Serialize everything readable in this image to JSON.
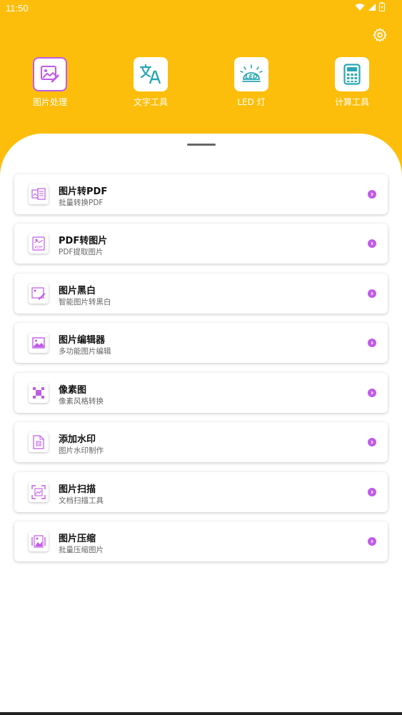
{
  "status_bar": {
    "time": "11:50"
  },
  "colors": {
    "header_bg": "#FDBE0B",
    "accent": "#C15BE8"
  },
  "top_tools": [
    {
      "label": "图片处理",
      "icon": "image-edit-icon",
      "active": true
    },
    {
      "label": "文字工具",
      "icon": "translate-icon",
      "active": false
    },
    {
      "label": "LED 灯",
      "icon": "led-icon",
      "active": false
    },
    {
      "label": "计算工具",
      "icon": "calculator-icon",
      "active": false
    }
  ],
  "features": [
    {
      "title": "图片转PDF",
      "subtitle": "批量转换PDF",
      "icon": "image-to-pdf-icon"
    },
    {
      "title": "PDF转图片",
      "subtitle": "PDF提取图片",
      "icon": "pdf-to-image-icon"
    },
    {
      "title": "图片黑白",
      "subtitle": "智能图片转黑白",
      "icon": "black-white-icon"
    },
    {
      "title": "图片编辑器",
      "subtitle": "多功能图片编辑",
      "icon": "image-editor-icon"
    },
    {
      "title": "像素图",
      "subtitle": "像素风格转换",
      "icon": "pixel-icon"
    },
    {
      "title": "添加水印",
      "subtitle": "图片水印制作",
      "icon": "watermark-icon"
    },
    {
      "title": "图片扫描",
      "subtitle": "文档扫描工具",
      "icon": "scan-icon"
    },
    {
      "title": "图片压缩",
      "subtitle": "批量压缩图片",
      "icon": "compress-icon"
    }
  ]
}
